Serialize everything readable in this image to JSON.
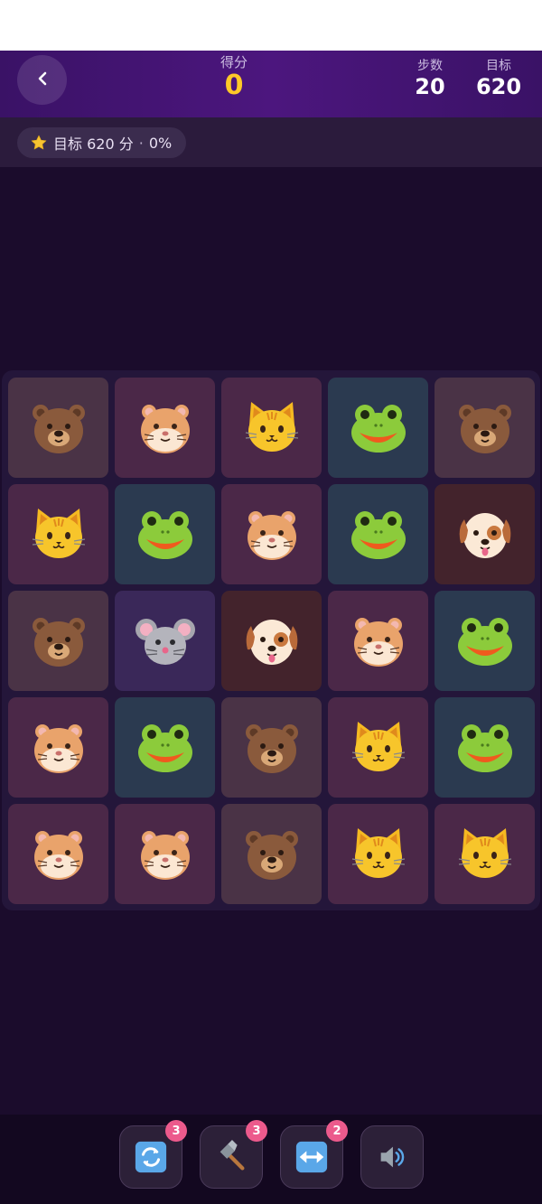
{
  "header": {
    "back_icon": "chevron-left-icon",
    "score_label": "得分",
    "score_value": "0",
    "moves_label": "步数",
    "moves_value": "20",
    "target_label": "目标",
    "target_value": "620"
  },
  "goal_bar": {
    "icon": "star-icon",
    "text": "目标 620 分",
    "separator": "·",
    "progress": "0%"
  },
  "board": {
    "rows": 5,
    "cols": 5,
    "tiles": [
      [
        "bear",
        "hamster",
        "cat",
        "frog",
        "bear"
      ],
      [
        "cat",
        "frog",
        "hamster",
        "frog",
        "dog"
      ],
      [
        "bear",
        "mouse",
        "dog",
        "hamster",
        "frog"
      ],
      [
        "hamster",
        "frog",
        "bear",
        "cat",
        "frog"
      ],
      [
        "hamster",
        "hamster",
        "bear",
        "cat",
        "cat"
      ]
    ]
  },
  "tools": [
    {
      "name": "shuffle",
      "icon": "shuffle-icon",
      "count": "3"
    },
    {
      "name": "hammer",
      "icon": "hammer-icon",
      "count": "3"
    },
    {
      "name": "swap",
      "icon": "swap-icon",
      "count": "2"
    },
    {
      "name": "sound",
      "icon": "speaker-icon",
      "count": ""
    }
  ],
  "colors": {
    "score": "#ffc928",
    "badge": "#ec5a8c",
    "header": "#4c167e",
    "background": "#1b0c2c"
  }
}
